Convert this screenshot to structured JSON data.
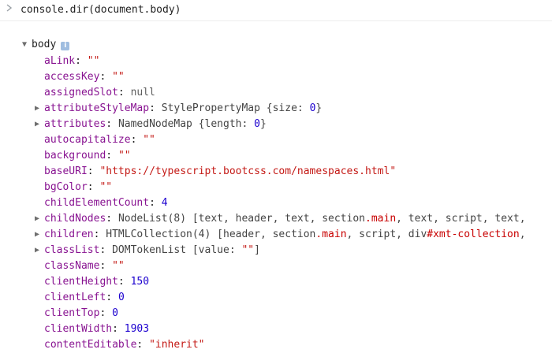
{
  "console": {
    "prompt_icon": "chevron-right-icon",
    "command": "console.dir(document.body)"
  },
  "object": {
    "name": "body",
    "info_icon": "info-icon",
    "info_glyph": "i"
  },
  "properties": [
    {
      "key": "aLink",
      "expandable": false,
      "parts": [
        {
          "t": "\"\"",
          "c": "str"
        }
      ]
    },
    {
      "key": "accessKey",
      "expandable": false,
      "parts": [
        {
          "t": "\"\"",
          "c": "str"
        }
      ]
    },
    {
      "key": "assignedSlot",
      "expandable": false,
      "parts": [
        {
          "t": "null",
          "c": "null"
        }
      ]
    },
    {
      "key": "attributeStyleMap",
      "expandable": true,
      "parts": [
        {
          "t": "StylePropertyMap {size: ",
          "c": "type"
        },
        {
          "t": "0",
          "c": "num"
        },
        {
          "t": "}",
          "c": "type"
        }
      ]
    },
    {
      "key": "attributes",
      "expandable": true,
      "parts": [
        {
          "t": "NamedNodeMap {length: ",
          "c": "type"
        },
        {
          "t": "0",
          "c": "num"
        },
        {
          "t": "}",
          "c": "type"
        }
      ]
    },
    {
      "key": "autocapitalize",
      "expandable": false,
      "parts": [
        {
          "t": "\"\"",
          "c": "str"
        }
      ]
    },
    {
      "key": "background",
      "expandable": false,
      "parts": [
        {
          "t": "\"\"",
          "c": "str"
        }
      ]
    },
    {
      "key": "baseURI",
      "expandable": false,
      "parts": [
        {
          "t": "\"",
          "c": "str"
        },
        {
          "t": "https://typescript.bootcss.com/namespaces.html",
          "c": "str"
        },
        {
          "t": "\"",
          "c": "str"
        }
      ]
    },
    {
      "key": "bgColor",
      "expandable": false,
      "parts": [
        {
          "t": "\"\"",
          "c": "str"
        }
      ]
    },
    {
      "key": "childElementCount",
      "expandable": false,
      "parts": [
        {
          "t": "4",
          "c": "num"
        }
      ]
    },
    {
      "key": "childNodes",
      "expandable": true,
      "parts": [
        {
          "t": "NodeList(8) [text, header, text, section",
          "c": "type"
        },
        {
          "t": ".main",
          "c": "cls"
        },
        {
          "t": ", text, script, text,",
          "c": "type"
        }
      ]
    },
    {
      "key": "children",
      "expandable": true,
      "parts": [
        {
          "t": "HTMLCollection(4) [header, section",
          "c": "type"
        },
        {
          "t": ".main",
          "c": "cls"
        },
        {
          "t": ", script, div",
          "c": "type"
        },
        {
          "t": "#xmt-collection",
          "c": "cls"
        },
        {
          "t": ",",
          "c": "type"
        }
      ]
    },
    {
      "key": "classList",
      "expandable": true,
      "parts": [
        {
          "t": "DOMTokenList [value: ",
          "c": "type"
        },
        {
          "t": "\"\"",
          "c": "str"
        },
        {
          "t": "]",
          "c": "type"
        }
      ]
    },
    {
      "key": "className",
      "expandable": false,
      "parts": [
        {
          "t": "\"\"",
          "c": "str"
        }
      ]
    },
    {
      "key": "clientHeight",
      "expandable": false,
      "parts": [
        {
          "t": "150",
          "c": "num"
        }
      ]
    },
    {
      "key": "clientLeft",
      "expandable": false,
      "parts": [
        {
          "t": "0",
          "c": "num"
        }
      ]
    },
    {
      "key": "clientTop",
      "expandable": false,
      "parts": [
        {
          "t": "0",
          "c": "num"
        }
      ]
    },
    {
      "key": "clientWidth",
      "expandable": false,
      "parts": [
        {
          "t": "1903",
          "c": "num"
        }
      ]
    },
    {
      "key": "contentEditable",
      "expandable": false,
      "parts": [
        {
          "t": "\"inherit\"",
          "c": "str"
        }
      ]
    }
  ]
}
